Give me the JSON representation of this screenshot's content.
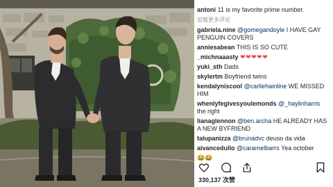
{
  "post": {
    "caption_user": "antoni",
    "caption_text": "11 is my favorite prime number.",
    "load_more_label": "加载更多评论",
    "likes_count": "330,137",
    "likes_suffix": " 次赞"
  },
  "comments": [
    {
      "user": "gabriela.nine",
      "mention": "@gomegandoyle",
      "text": " I HAVE GAY PENGUIN COVERS"
    },
    {
      "user": "anniesabean",
      "text": "THIS IS SO CUTE"
    },
    {
      "user": "_michnaaasty",
      "hearts": "❤❤❤❤❤"
    },
    {
      "user": "yuki_sth",
      "text": "Dads"
    },
    {
      "user": "skylertm",
      "text": "Boyfriend twins"
    },
    {
      "user": "kendalyniscool",
      "mention": "@carliehainline",
      "text": " WE MISSED HIM"
    },
    {
      "user": "whenlyfegivesyoulemonds",
      "mention": "@_haylinharris",
      "text": " the right"
    },
    {
      "user": "lianaglennon",
      "mention": "@ben.archa",
      "text": " HE ALREADY HAS A NEW BYFRIEND"
    },
    {
      "user": "talupanizza",
      "mention": "@brunadvc",
      "text": " deuso da vida"
    },
    {
      "user": "aivancedullo",
      "mention": "@caramelbarrs",
      "text": " Yea october"
    },
    {
      "emoji": "😂😂"
    }
  ],
  "icons": {
    "like": "heart-icon",
    "comment": "comment-bubble-icon",
    "share": "share-upload-icon",
    "save": "bookmark-icon"
  },
  "colors": {
    "mention": "#003569",
    "heart": "#ed4956",
    "text": "#262626",
    "muted": "#999999"
  }
}
